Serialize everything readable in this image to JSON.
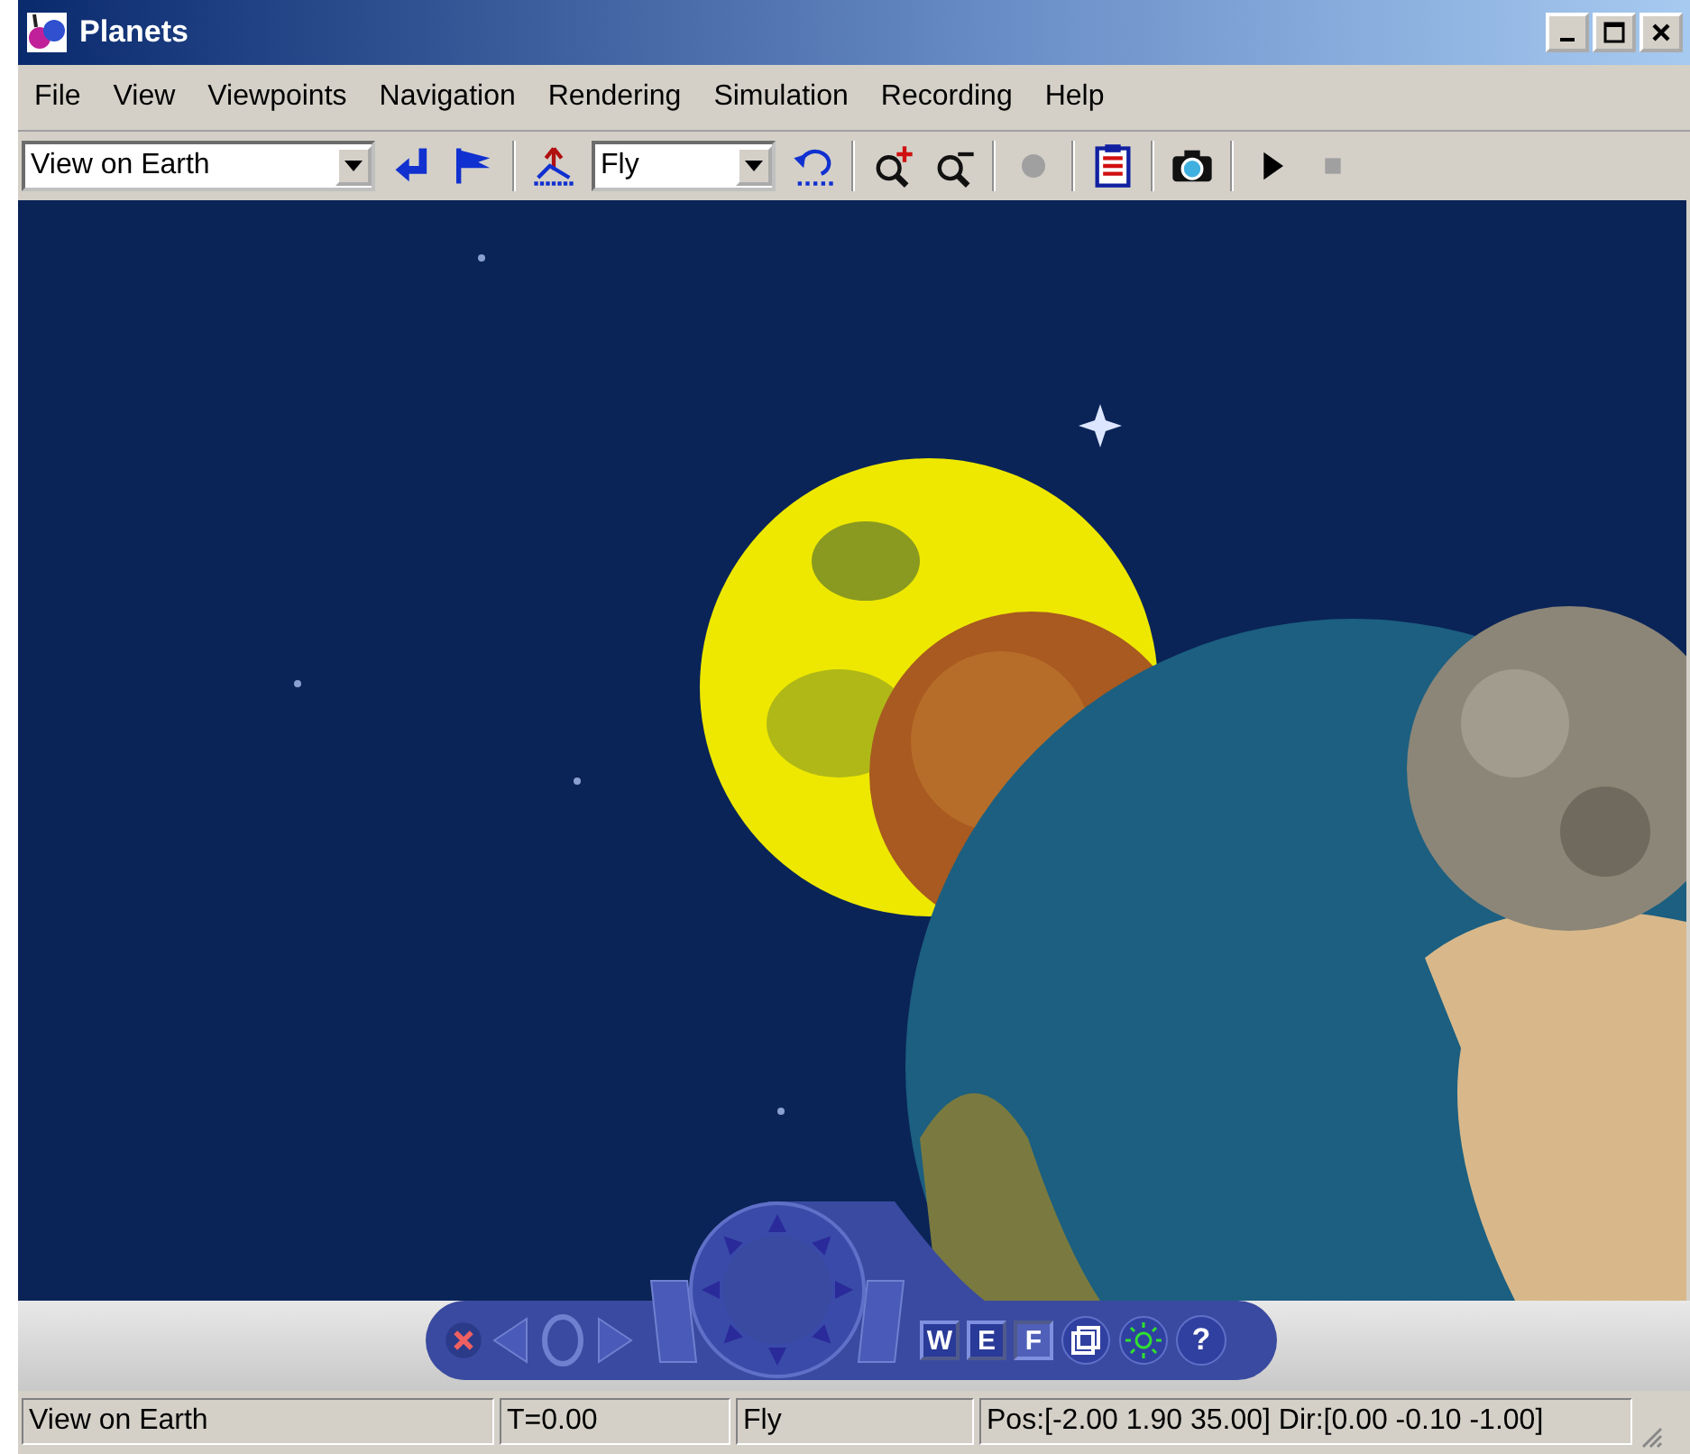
{
  "window": {
    "title": "Planets"
  },
  "menu": [
    "File",
    "View",
    "Viewpoints",
    "Navigation",
    "Rendering",
    "Simulation",
    "Recording",
    "Help"
  ],
  "toolbar": {
    "viewpoint_select": {
      "value": "View on Earth"
    },
    "navigation_select": {
      "value": "Fly"
    }
  },
  "navigator": {
    "modes": [
      {
        "label": "W",
        "selected": false
      },
      {
        "label": "E",
        "selected": false
      },
      {
        "label": "F",
        "selected": true
      }
    ],
    "help_label": "?"
  },
  "status_bar": [
    "View on Earth",
    "T=0.00",
    "Fly",
    "Pos:[-2.00 1.90 35.00] Dir:[0.00 -0.10 -1.00]"
  ]
}
